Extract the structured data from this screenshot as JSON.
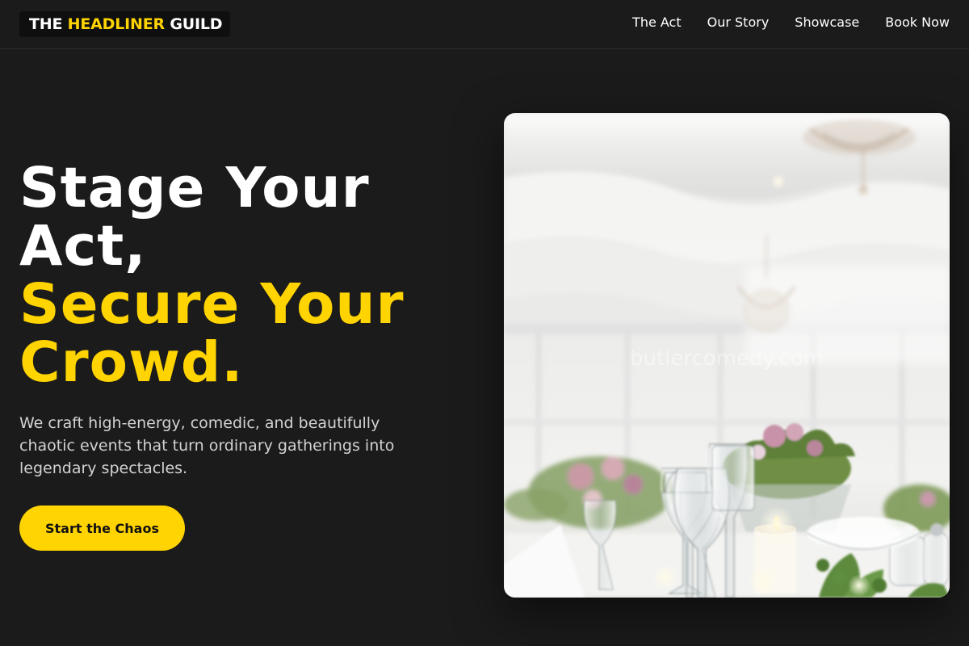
{
  "brand": {
    "logo_part1": "THE ",
    "logo_part2": "HEADLINER",
    "logo_part3": " GUILD"
  },
  "nav": {
    "items": [
      {
        "label": "The Act"
      },
      {
        "label": "Our Story"
      },
      {
        "label": "Showcase"
      },
      {
        "label": "Book Now"
      }
    ]
  },
  "hero": {
    "headline_line1": "Stage Your",
    "headline_line2": "Act,",
    "headline_line3": "Secure Your",
    "headline_line4": "Crowd.",
    "subtext": "We craft high-energy, comedic, and beautifully chaotic events that turn ordinary gatherings into legendary spectacles.",
    "cta_label": "Start the Chaos",
    "image_watermark": "butlercomedy.com"
  },
  "colors": {
    "background": "#1b1b1b",
    "accent": "#ffd400",
    "text": "#ffffff",
    "muted_text": "#d2d2d2"
  }
}
